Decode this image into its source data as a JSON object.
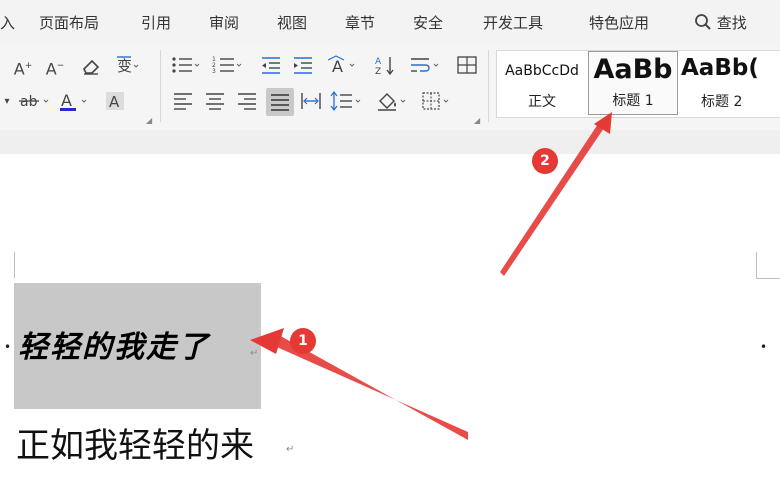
{
  "menu": {
    "partial_left": "入",
    "page_layout": "页面布局",
    "references": "引用",
    "review": "审阅",
    "view": "视图",
    "chapter": "章节",
    "security": "安全",
    "developer": "开发工具",
    "special_apps": "特色应用",
    "search": "查找"
  },
  "ribbon": {
    "font_color": "#2a2ad4",
    "accent_color": "#2a6fd4"
  },
  "styles": {
    "normal": {
      "sample": "AaBbCcDd",
      "name": "正文"
    },
    "heading1": {
      "sample": "AaBb",
      "name": "标题 1"
    },
    "heading2": {
      "sample": "AaBb(",
      "name": "标题 2"
    }
  },
  "document": {
    "line1": "轻轻的我走了",
    "line2": "正如我轻轻的来",
    "paragraph_mark": "↵"
  },
  "annotations": {
    "badge1": "1",
    "badge2": "2",
    "color": "#e53935"
  }
}
